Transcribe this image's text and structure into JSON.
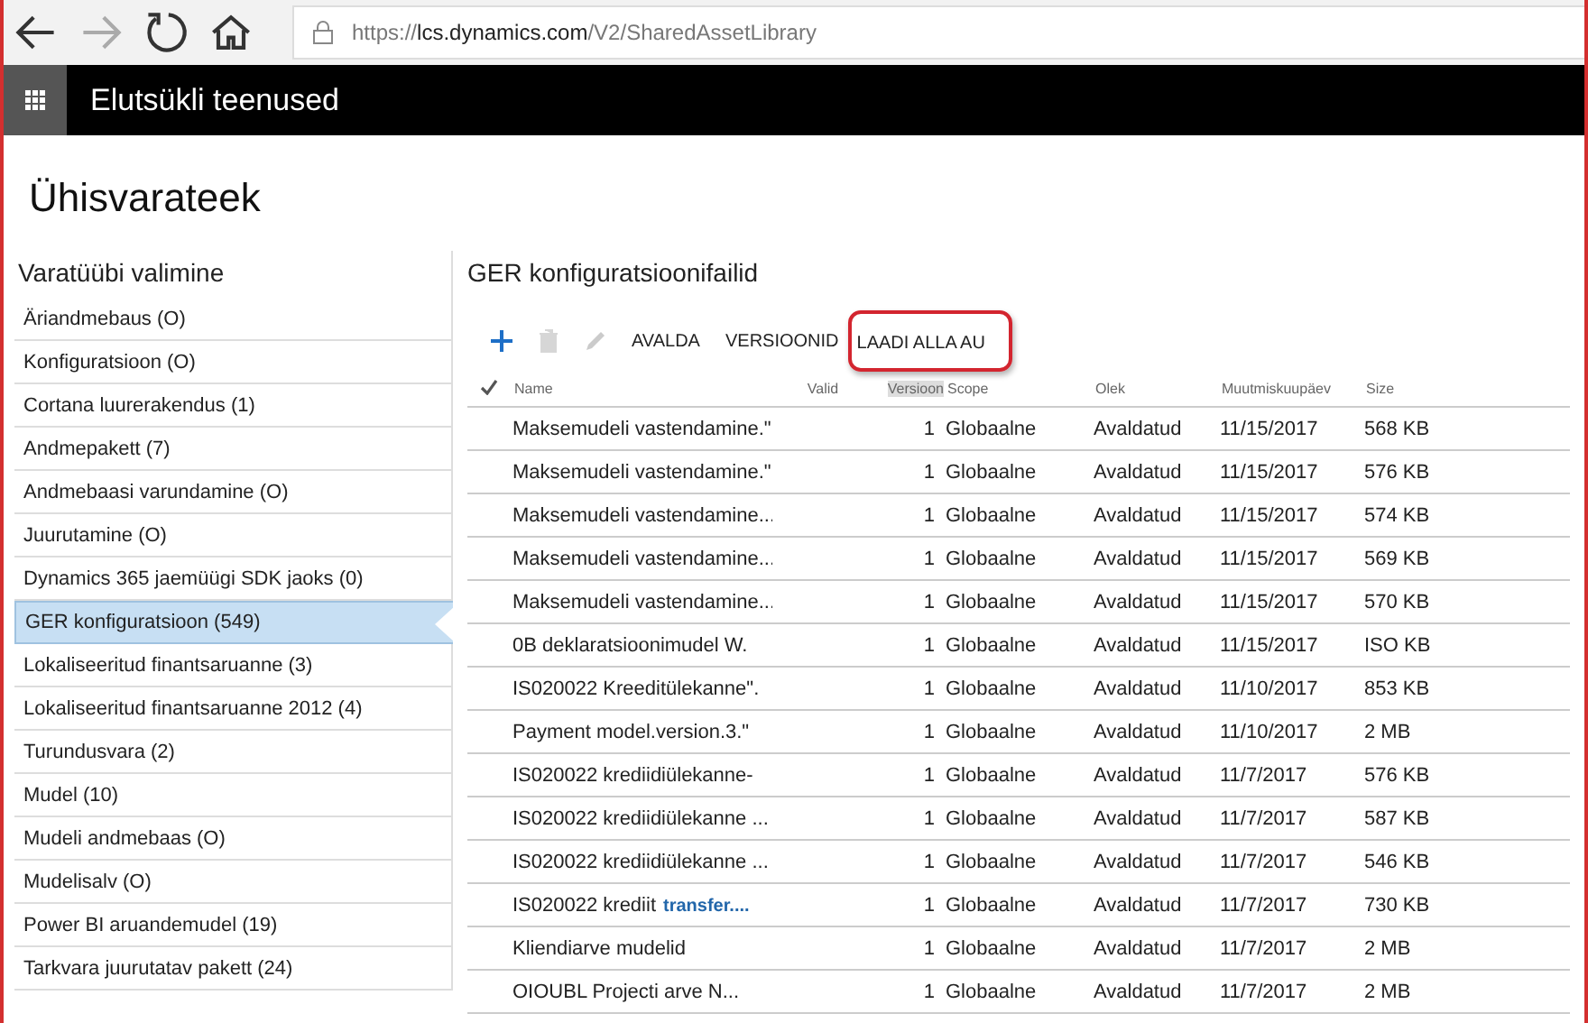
{
  "browser": {
    "url_prefix": "https://",
    "url_host": "lcs.dynamics.com",
    "url_path": "/V2/SharedAssetLibrary"
  },
  "app_bar": {
    "title": "Elutsükli teenused"
  },
  "page_title": "Ühisvarateek",
  "sidebar": {
    "title": "Varatüübi valimine",
    "items": [
      {
        "label": "Äriandmebaus (O)",
        "selected": false
      },
      {
        "label": "Konfiguratsioon (O)",
        "selected": false
      },
      {
        "label": "Cortana luurerakendus (1)",
        "selected": false
      },
      {
        "label": "Andmepakett (7)",
        "selected": false
      },
      {
        "label": "Andmebaasi varundamine (O)",
        "selected": false
      },
      {
        "label": "Juurutamine (O)",
        "selected": false
      },
      {
        "label": "Dynamics 365 jaemüügi SDK jaoks (0)",
        "selected": false
      },
      {
        "label": "GER konfiguratsioon (549)",
        "selected": true
      },
      {
        "label": "Lokaliseeritud finantsaruanne (3)",
        "selected": false
      },
      {
        "label": "Lokaliseeritud finantsaruanne 2012 (4)",
        "selected": false
      },
      {
        "label": "Turundusvara (2)",
        "selected": false
      },
      {
        "label": "Mudel (10)",
        "selected": false
      },
      {
        "label": "Mudeli andmebaas (O)",
        "selected": false
      },
      {
        "label": "Mudelisalv (O)",
        "selected": false
      },
      {
        "label": "Power BI aruandemudel (19)",
        "selected": false
      },
      {
        "label": "Tarkvara juurutatav pakett (24)",
        "selected": false
      }
    ]
  },
  "content": {
    "title": "GER konfiguratsioonifailid",
    "toolbar": [
      {
        "kind": "add",
        "disabled": false
      },
      {
        "kind": "delete",
        "disabled": true
      },
      {
        "kind": "edit",
        "disabled": true
      },
      {
        "kind": "text",
        "label": "AVALDA",
        "highlighted": false
      },
      {
        "kind": "text",
        "label": "VERSIOONID",
        "highlighted": false
      },
      {
        "kind": "text",
        "label": "LAADI ALLA AU",
        "highlighted": true
      }
    ],
    "table": {
      "columns": [
        "Name",
        "Valid",
        "Versioon",
        "Scope",
        "Olek",
        "Muutmiskuupäev",
        "Size"
      ],
      "rows": [
        {
          "name": "Maksemudeli vastendamine.\"",
          "version": "1",
          "scope": "Globaalne",
          "state": "Avaldatud",
          "date": "11/15/2017",
          "size": "568 KB"
        },
        {
          "name": "Maksemudeli vastendamine.\"",
          "version": "1",
          "scope": "Globaalne",
          "state": "Avaldatud",
          "date": "11/15/2017",
          "size": "576 KB"
        },
        {
          "name": "Maksemudeli vastendamine...",
          "version": "1",
          "scope": "Globaalne",
          "state": "Avaldatud",
          "date": "11/15/2017",
          "size": "574 KB"
        },
        {
          "name": "Maksemudeli vastendamine...",
          "version": "1",
          "scope": "Globaalne",
          "state": "Avaldatud",
          "date": "11/15/2017",
          "size": "569 KB"
        },
        {
          "name": "Maksemudeli vastendamine...",
          "version": "1",
          "scope": "Globaalne",
          "state": "Avaldatud",
          "date": "11/15/2017",
          "size": "570 KB"
        },
        {
          "name": "0B deklaratsioonimudel W.",
          "version": "1",
          "scope": "Globaalne",
          "state": "Avaldatud",
          "date": "11/15/2017",
          "size": "ISO KB"
        },
        {
          "name": "IS020022 Kreeditülekanne\".",
          "version": "1",
          "scope": "Globaalne",
          "state": "Avaldatud",
          "date": "11/10/2017",
          "size": "853 KB"
        },
        {
          "name": "Payment model.version.3.\"",
          "version": "1",
          "scope": "Globaalne",
          "state": "Avaldatud",
          "date": "11/10/2017",
          "size": "2 MB"
        },
        {
          "name": "IS020022 krediidiülekanne-",
          "version": "1",
          "scope": "Globaalne",
          "state": "Avaldatud",
          "date": "11/7/2017",
          "size": "576 KB"
        },
        {
          "name": "IS020022 krediidiülekanne ...",
          "version": "1",
          "scope": "Globaalne",
          "state": "Avaldatud",
          "date": "11/7/2017",
          "size": "587 KB"
        },
        {
          "name": "IS020022 krediidiülekanne ...",
          "version": "1",
          "scope": "Globaalne",
          "state": "Avaldatud",
          "date": "11/7/2017",
          "size": "546 KB"
        },
        {
          "name": "IS020022 krediit",
          "link": "transfer....",
          "version": "1",
          "scope": "Globaalne",
          "state": "Avaldatud",
          "date": "11/7/2017",
          "size": "730 KB"
        },
        {
          "name": "Kliendiarve mudelid",
          "version": "1",
          "scope": "Globaalne",
          "state": "Avaldatud",
          "date": "11/7/2017",
          "size": "2 MB"
        },
        {
          "name": "OIOUBL Projecti arve N...",
          "version": "1",
          "scope": "Globaalne",
          "state": "Avaldatud",
          "date": "11/7/2017",
          "size": "2 MB"
        }
      ]
    }
  }
}
